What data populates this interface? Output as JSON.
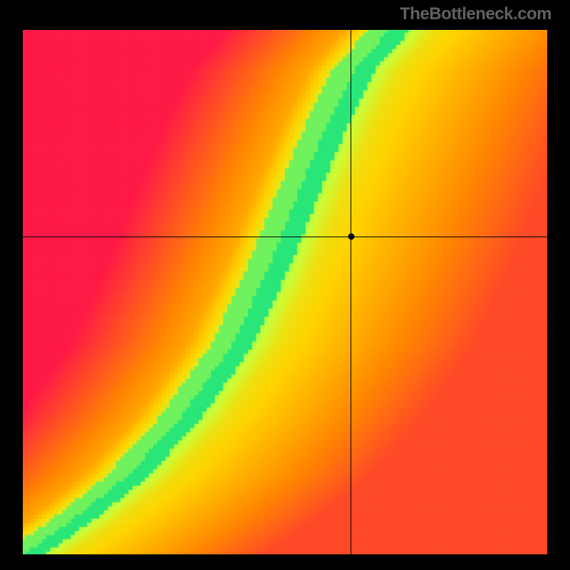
{
  "branding": {
    "watermark": "TheBottleneck.com"
  },
  "chart_data": {
    "type": "heatmap",
    "title": "",
    "xlabel": "",
    "ylabel": "",
    "xlim": [
      0,
      1
    ],
    "ylim": [
      0,
      1
    ],
    "grid": false,
    "legend": false,
    "crosshair": {
      "x": 0.625,
      "y": 0.605
    },
    "marker": {
      "x": 0.625,
      "y": 0.605
    },
    "ridge": {
      "description": "Curve of optimal (green) match from bottom-left to top; surrounding field shifts yellow→orange→red with distance from ridge.",
      "control_points": [
        {
          "x": 0.0,
          "y": 0.0
        },
        {
          "x": 0.1,
          "y": 0.07
        },
        {
          "x": 0.2,
          "y": 0.15
        },
        {
          "x": 0.3,
          "y": 0.26
        },
        {
          "x": 0.4,
          "y": 0.4
        },
        {
          "x": 0.47,
          "y": 0.55
        },
        {
          "x": 0.53,
          "y": 0.7
        },
        {
          "x": 0.58,
          "y": 0.82
        },
        {
          "x": 0.63,
          "y": 0.92
        },
        {
          "x": 0.7,
          "y": 1.0
        }
      ],
      "green_half_width": 0.04,
      "yellow_half_width": 0.085
    },
    "color_stops": [
      {
        "t": 0.0,
        "hex": "#00e08a"
      },
      {
        "t": 0.2,
        "hex": "#c8ff3c"
      },
      {
        "t": 0.4,
        "hex": "#ffd400"
      },
      {
        "t": 0.65,
        "hex": "#ff8a00"
      },
      {
        "t": 1.0,
        "hex": "#ff1a47"
      }
    ]
  }
}
